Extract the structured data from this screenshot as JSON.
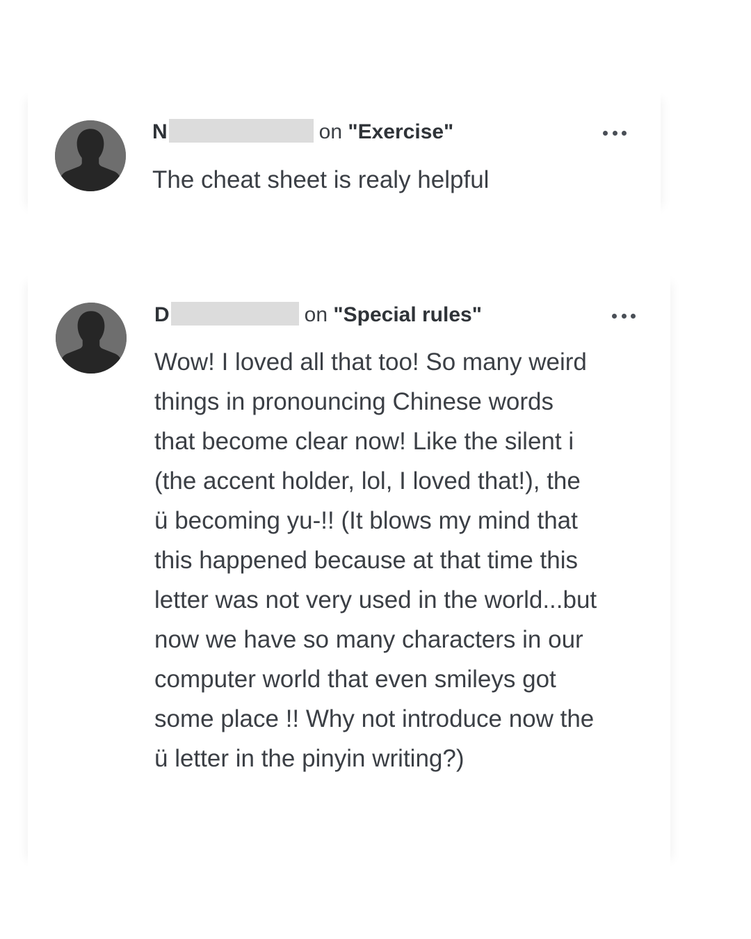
{
  "comments": [
    {
      "author_initial": "N",
      "on_label": "on",
      "target": "\"Exercise\"",
      "text": "The cheat sheet is realy helpful",
      "more_icon": "ellipsis-horizontal-icon"
    },
    {
      "author_initial": "D",
      "on_label": "on",
      "target": "\"Special rules\"",
      "text": "Wow! I loved all that too! So many weird things in pronouncing Chinese words that become clear now! Like the silent i (the accent holder, lol, I loved that!), the ü becoming yu-!! (It blows my mind that this happened because at that time this letter was not very used in the world...but now we have so many characters in our computer world that even smileys got some place !! Why not introduce now the ü letter in the pinyin writing?)",
      "more_icon": "ellipsis-horizontal-icon"
    }
  ],
  "colors": {
    "avatar_bg": "#6e6e6e",
    "avatar_silhouette": "#262626",
    "redaction": "#dcdcdc",
    "text": "#3b3f45"
  }
}
